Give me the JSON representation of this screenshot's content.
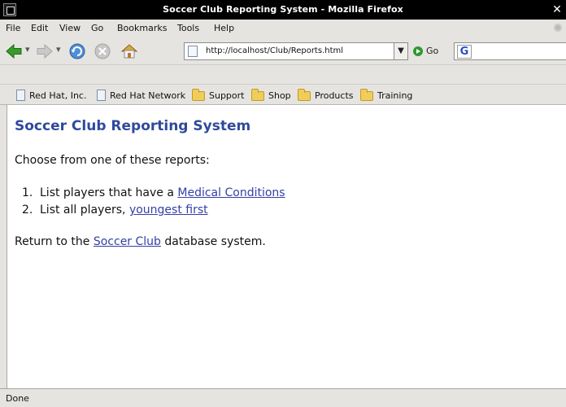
{
  "window": {
    "title": "Soccer Club Reporting System - Mozilla Firefox",
    "close_glyph": "✕"
  },
  "menubar": {
    "items": [
      "File",
      "Edit",
      "View",
      "Go",
      "Bookmarks",
      "Tools",
      "Help"
    ]
  },
  "navbar": {
    "url": "http://localhost/Club/Reports.html",
    "go_label": "Go",
    "search_engine_glyph": "G",
    "icons": [
      "back-icon",
      "forward-icon",
      "reload-icon",
      "stop-icon",
      "home-icon"
    ]
  },
  "bookmarks": {
    "items": [
      {
        "label": "Red Hat, Inc.",
        "icon": "page-icon"
      },
      {
        "label": "Red Hat Network",
        "icon": "page-icon"
      },
      {
        "label": "Support",
        "icon": "folder-icon"
      },
      {
        "label": "Shop",
        "icon": "folder-icon"
      },
      {
        "label": "Products",
        "icon": "folder-icon"
      },
      {
        "label": "Training",
        "icon": "folder-icon"
      }
    ]
  },
  "page": {
    "heading": "Soccer Club Reporting System",
    "intro": "Choose from one of these reports:",
    "reports": [
      {
        "number": "1.",
        "text": "List players that have a ",
        "link": "Medical Conditions"
      },
      {
        "number": "2.",
        "text": "List all players, ",
        "link": "youngest first"
      }
    ],
    "return_prefix": "Return to the ",
    "return_link": "Soccer Club",
    "return_suffix": " database system."
  },
  "status": {
    "text": "Done"
  },
  "colors": {
    "heading": "#2f4a9c",
    "link": "#3440a8",
    "titlebar": "#000000",
    "chrome": "#e6e4e0"
  }
}
